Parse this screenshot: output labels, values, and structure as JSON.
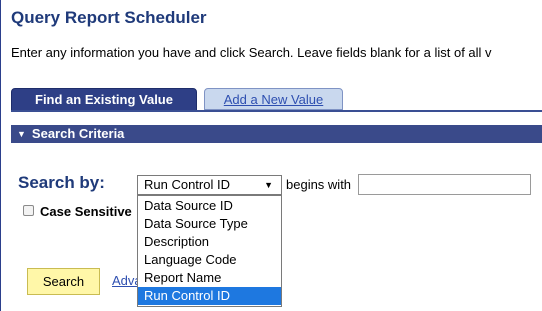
{
  "page": {
    "title": "Query Report Scheduler",
    "instructions": "Enter any information you have and click Search. Leave fields blank for a list of all v"
  },
  "tabs": [
    {
      "label": "Find an Existing Value",
      "active": true
    },
    {
      "label": "Add a New Value",
      "active": false
    }
  ],
  "section": {
    "label": "Search Criteria",
    "expanded": true
  },
  "search": {
    "search_by_label": "Search by:",
    "selected_field": "Run Control ID",
    "operator_label": "begins with",
    "input_value": "",
    "case_sensitive_label": "Case Sensitive",
    "case_sensitive_checked": false,
    "search_button_label": "Search",
    "advanced_link_label": "Advanced Search"
  },
  "dropdown": {
    "options": [
      "Data Source ID",
      "Data Source Type",
      "Description",
      "Language Code",
      "Report Name",
      "Run Control ID"
    ],
    "selected_index": 5
  },
  "colors": {
    "accent": "#2e3f86",
    "title": "#1f3a7a",
    "link": "#2e4fb0",
    "button": "#fff7a8",
    "selection": "#1e78e0"
  }
}
